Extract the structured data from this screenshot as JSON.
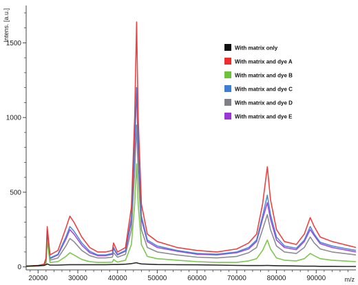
{
  "chart_data": {
    "type": "line",
    "ylabel": "Intens. [a.u.]",
    "xlabel": "m/z",
    "xlim": [
      17000,
      100000
    ],
    "ylim": [
      -20,
      1750
    ],
    "x_ticks": [
      20000,
      30000,
      40000,
      50000,
      60000,
      70000,
      80000,
      90000
    ],
    "y_ticks": [
      0,
      500,
      1000,
      1500
    ],
    "grid": false,
    "legend_position": "top-right",
    "x": [
      17000,
      20000,
      21500,
      22000,
      22300,
      23000,
      25000,
      27000,
      28000,
      29000,
      31000,
      33000,
      35000,
      37000,
      38700,
      39000,
      39500,
      40000,
      42000,
      43500,
      44300,
      44800,
      45200,
      46000,
      47500,
      50000,
      55000,
      60000,
      65000,
      70000,
      73000,
      75000,
      76500,
      77700,
      78500,
      80000,
      82000,
      85000,
      87000,
      88500,
      89500,
      91000,
      94000,
      97000,
      100000
    ],
    "series": [
      {
        "name": "With matrix only",
        "color": "#111111",
        "values": [
          5,
          8,
          10,
          15,
          20,
          12,
          12,
          14,
          15,
          15,
          15,
          15,
          15,
          15,
          16,
          16,
          16,
          16,
          18,
          22,
          26,
          28,
          24,
          20,
          18,
          16,
          15,
          14,
          12,
          10,
          9,
          9,
          9,
          10,
          9,
          8,
          7,
          6,
          5,
          5,
          5,
          4,
          4,
          3,
          3
        ]
      },
      {
        "name": "With matrix and dye A",
        "color": "#f02b2b",
        "values": [
          5,
          10,
          18,
          60,
          270,
          80,
          110,
          260,
          340,
          300,
          200,
          130,
          100,
          100,
          110,
          160,
          130,
          100,
          130,
          400,
          1000,
          1640,
          1000,
          420,
          220,
          170,
          130,
          110,
          100,
          120,
          160,
          220,
          420,
          670,
          450,
          250,
          170,
          150,
          220,
          330,
          270,
          200,
          170,
          150,
          130
        ]
      },
      {
        "name": "With matrix and dye B",
        "color": "#6ec23a",
        "values": [
          3,
          6,
          10,
          25,
          180,
          30,
          35,
          70,
          95,
          80,
          50,
          35,
          30,
          30,
          32,
          50,
          40,
          32,
          45,
          150,
          420,
          690,
          420,
          150,
          70,
          55,
          45,
          35,
          30,
          30,
          40,
          55,
          110,
          180,
          120,
          60,
          45,
          40,
          55,
          90,
          75,
          55,
          45,
          40,
          35
        ]
      },
      {
        "name": "With matrix and dye C",
        "color": "#3a7fd5",
        "values": [
          4,
          8,
          14,
          45,
          240,
          60,
          85,
          200,
          270,
          240,
          160,
          105,
          80,
          80,
          90,
          130,
          105,
          85,
          110,
          330,
          840,
          1200,
          840,
          340,
          180,
          140,
          110,
          90,
          85,
          100,
          130,
          180,
          340,
          480,
          350,
          200,
          140,
          125,
          180,
          270,
          220,
          165,
          140,
          125,
          110
        ]
      },
      {
        "name": "With matrix and dye D",
        "color": "#7f7f86",
        "values": [
          4,
          7,
          12,
          35,
          200,
          45,
          60,
          140,
          190,
          170,
          110,
          75,
          60,
          60,
          65,
          95,
          80,
          65,
          85,
          250,
          640,
          950,
          640,
          250,
          130,
          100,
          80,
          65,
          60,
          70,
          95,
          130,
          250,
          350,
          250,
          140,
          100,
          90,
          130,
          200,
          160,
          120,
          100,
          90,
          80
        ]
      },
      {
        "name": "With matrix and dye E",
        "color": "#9b35d8",
        "values": [
          4,
          8,
          14,
          40,
          230,
          55,
          80,
          185,
          250,
          220,
          145,
          95,
          75,
          75,
          85,
          125,
          100,
          80,
          105,
          310,
          800,
          1200,
          800,
          320,
          170,
          130,
          105,
          85,
          80,
          95,
          120,
          170,
          320,
          430,
          320,
          180,
          130,
          115,
          170,
          250,
          210,
          155,
          130,
          115,
          100
        ]
      }
    ]
  }
}
